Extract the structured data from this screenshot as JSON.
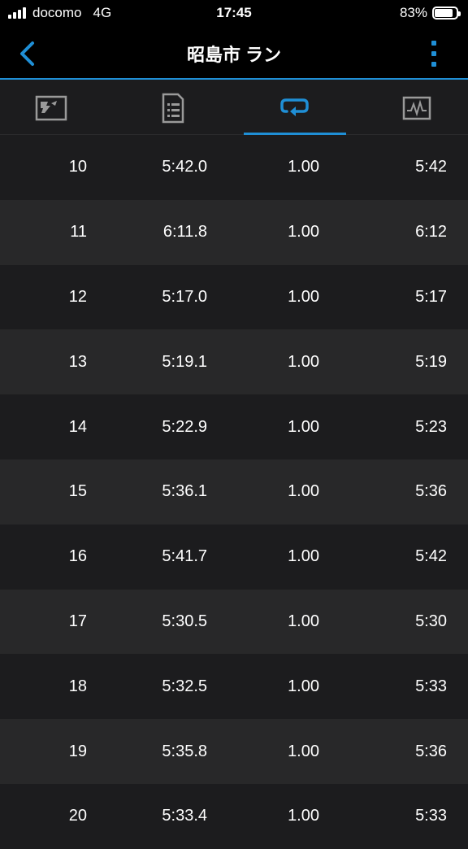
{
  "status": {
    "carrier": "docomo",
    "network": "4G",
    "time": "17:45",
    "battery": "83%",
    "battery_level": 0.83
  },
  "nav": {
    "title": "昭島市 ラン",
    "accent_color": "#1f8fd6"
  },
  "tabs": [
    {
      "icon": "map-icon",
      "active": false
    },
    {
      "icon": "details-list-icon",
      "active": false
    },
    {
      "icon": "laps-loop-icon",
      "active": true
    },
    {
      "icon": "chart-icon",
      "active": false
    }
  ],
  "laps": [
    {
      "lap": "10",
      "time": "5:42.0",
      "distance": "1.00",
      "pace": "5:42"
    },
    {
      "lap": "11",
      "time": "6:11.8",
      "distance": "1.00",
      "pace": "6:12"
    },
    {
      "lap": "12",
      "time": "5:17.0",
      "distance": "1.00",
      "pace": "5:17"
    },
    {
      "lap": "13",
      "time": "5:19.1",
      "distance": "1.00",
      "pace": "5:19"
    },
    {
      "lap": "14",
      "time": "5:22.9",
      "distance": "1.00",
      "pace": "5:23"
    },
    {
      "lap": "15",
      "time": "5:36.1",
      "distance": "1.00",
      "pace": "5:36"
    },
    {
      "lap": "16",
      "time": "5:41.7",
      "distance": "1.00",
      "pace": "5:42"
    },
    {
      "lap": "17",
      "time": "5:30.5",
      "distance": "1.00",
      "pace": "5:30"
    },
    {
      "lap": "18",
      "time": "5:32.5",
      "distance": "1.00",
      "pace": "5:33"
    },
    {
      "lap": "19",
      "time": "5:35.8",
      "distance": "1.00",
      "pace": "5:36"
    },
    {
      "lap": "20",
      "time": "5:33.4",
      "distance": "1.00",
      "pace": "5:33"
    }
  ]
}
